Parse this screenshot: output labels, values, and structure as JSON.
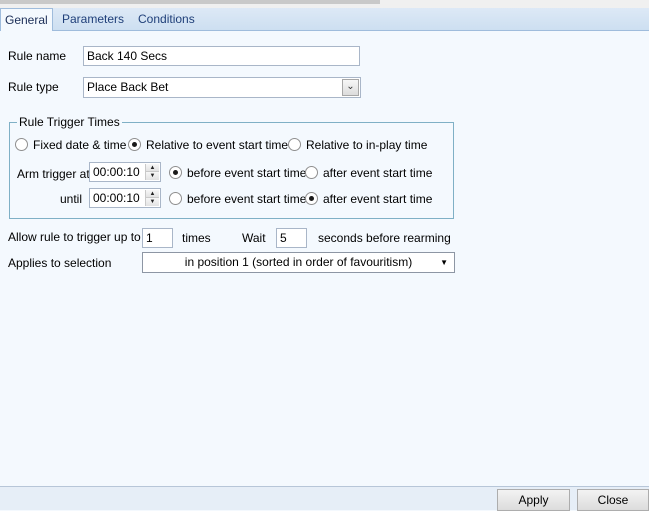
{
  "tabs": [
    {
      "label": "General",
      "active": true
    },
    {
      "label": "Parameters",
      "active": false
    },
    {
      "label": "Conditions",
      "active": false
    }
  ],
  "rule_name": {
    "label": "Rule name",
    "value": "Back 140 Secs"
  },
  "rule_type": {
    "label": "Rule type",
    "value": "Place Back Bet"
  },
  "trigger_times": {
    "title": "Rule Trigger Times",
    "modes": [
      {
        "label": "Fixed date & time",
        "checked": false
      },
      {
        "label": "Relative to event start time",
        "checked": true
      },
      {
        "label": "Relative to in-play time",
        "checked": false
      }
    ],
    "arm": {
      "label": "Arm trigger at",
      "value": "00:00:10",
      "before_label": "before event start time",
      "after_label": "after event start time",
      "selected": "before"
    },
    "until": {
      "label": "until",
      "value": "00:00:10",
      "before_label": "before event start time",
      "after_label": "after event start time",
      "selected": "after"
    }
  },
  "trigger_limit": {
    "label": "Allow rule to trigger up to",
    "value": "1",
    "times_label": "times",
    "wait_label": "Wait",
    "wait_value": "5",
    "seconds_label": "seconds before rearming"
  },
  "selection": {
    "label": "Applies to selection",
    "value": "in position 1 (sorted in order of favouritism)"
  },
  "buttons": {
    "apply": "Apply",
    "close": "Close"
  }
}
